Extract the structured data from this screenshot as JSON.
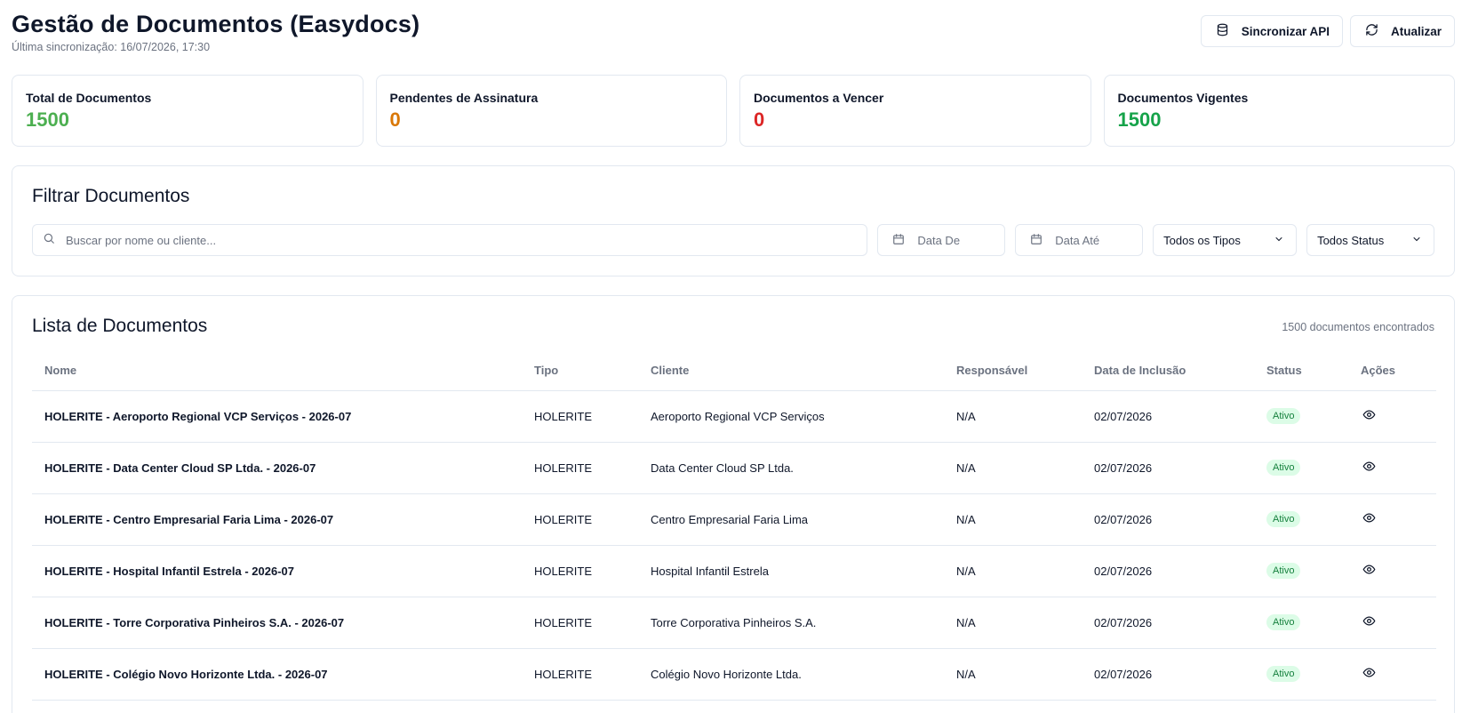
{
  "header": {
    "title": "Gestão de Documentos (Easydocs)",
    "sync_info": "Última sincronização: 16/07/2026, 17:30"
  },
  "actions": {
    "sync_label": "Sincronizar API",
    "refresh_label": "Atualizar"
  },
  "stats": [
    {
      "label": "Total de Documentos",
      "value": "1500",
      "color": "#4caf50"
    },
    {
      "label": "Pendentes de Assinatura",
      "value": "0",
      "color": "#d97706"
    },
    {
      "label": "Documentos a Vencer",
      "value": "0",
      "color": "#dc2626"
    },
    {
      "label": "Documentos Vigentes",
      "value": "1500",
      "color": "#16a34a"
    }
  ],
  "filters": {
    "title": "Filtrar Documentos",
    "search_placeholder": "Buscar por nome ou cliente...",
    "date_from": "Data De",
    "date_to": "Data Até",
    "type_select": "Todos os Tipos",
    "status_select": "Todos Status"
  },
  "list": {
    "title": "Lista de Documentos",
    "count": "1500 documentos encontrados",
    "columns": [
      "Nome",
      "Tipo",
      "Cliente",
      "Responsável",
      "Data de Inclusão",
      "Status",
      "Ações"
    ],
    "rows": [
      {
        "name": "HOLERITE - Aeroporto Regional VCP Serviços - 2026-07",
        "type": "HOLERITE",
        "client": "Aeroporto Regional VCP Serviços",
        "owner": "N/A",
        "date": "02/07/2026",
        "status": "Ativo"
      },
      {
        "name": "HOLERITE - Data Center Cloud SP Ltda. - 2026-07",
        "type": "HOLERITE",
        "client": "Data Center Cloud SP Ltda.",
        "owner": "N/A",
        "date": "02/07/2026",
        "status": "Ativo"
      },
      {
        "name": "HOLERITE - Centro Empresarial Faria Lima - 2026-07",
        "type": "HOLERITE",
        "client": "Centro Empresarial Faria Lima",
        "owner": "N/A",
        "date": "02/07/2026",
        "status": "Ativo"
      },
      {
        "name": "HOLERITE - Hospital Infantil Estrela - 2026-07",
        "type": "HOLERITE",
        "client": "Hospital Infantil Estrela",
        "owner": "N/A",
        "date": "02/07/2026",
        "status": "Ativo"
      },
      {
        "name": "HOLERITE - Torre Corporativa Pinheiros S.A. - 2026-07",
        "type": "HOLERITE",
        "client": "Torre Corporativa Pinheiros S.A.",
        "owner": "N/A",
        "date": "02/07/2026",
        "status": "Ativo"
      },
      {
        "name": "HOLERITE - Colégio Novo Horizonte Ltda. - 2026-07",
        "type": "HOLERITE",
        "client": "Colégio Novo Horizonte Ltda.",
        "owner": "N/A",
        "date": "02/07/2026",
        "status": "Ativo"
      }
    ]
  },
  "icons": {
    "sync": "database-icon",
    "refresh": "refresh-icon",
    "search": "search-icon",
    "calendar": "calendar-icon",
    "chevron": "chevron-down-icon",
    "view": "eye-icon"
  }
}
